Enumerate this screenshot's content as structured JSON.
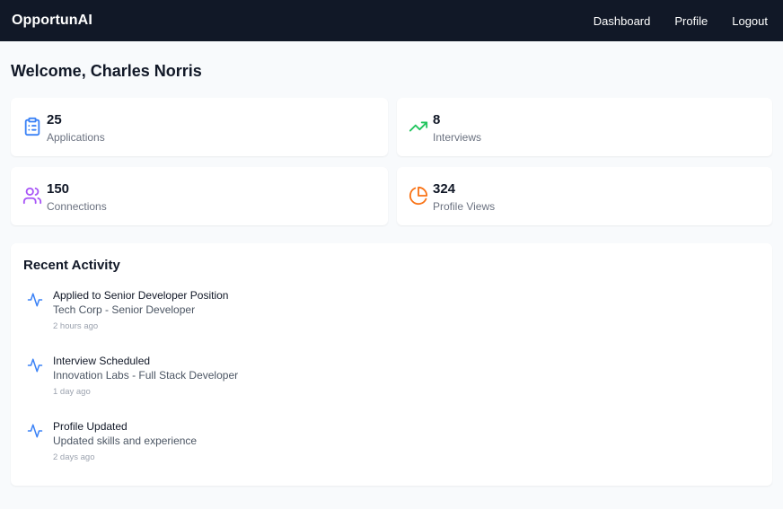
{
  "nav": {
    "brand": "OpportunAI",
    "links": [
      "Dashboard",
      "Profile",
      "Logout"
    ]
  },
  "welcome": "Welcome, Charles Norris",
  "stats": [
    {
      "value": "25",
      "label": "Applications",
      "icon": "clipboard-list-icon",
      "color": "#3b82f6"
    },
    {
      "value": "8",
      "label": "Interviews",
      "icon": "trending-up-icon",
      "color": "#22c55e"
    },
    {
      "value": "150",
      "label": "Connections",
      "icon": "users-icon",
      "color": "#a855f7"
    },
    {
      "value": "324",
      "label": "Profile Views",
      "icon": "pie-chart-icon",
      "color": "#f97316"
    }
  ],
  "activity": {
    "title": "Recent Activity",
    "items": [
      {
        "title": "Applied to Senior Developer Position",
        "subtitle": "Tech Corp - Senior Developer",
        "time": "2 hours ago",
        "icon": "activity-icon"
      },
      {
        "title": "Interview Scheduled",
        "subtitle": "Innovation Labs - Full Stack Developer",
        "time": "1 day ago",
        "icon": "activity-icon"
      },
      {
        "title": "Profile Updated",
        "subtitle": "Updated skills and experience",
        "time": "2 days ago",
        "icon": "activity-icon"
      }
    ]
  },
  "colors": {
    "nav_bg": "#111827",
    "page_bg": "#f8fafc",
    "activity_icon": "#3b82f6"
  }
}
